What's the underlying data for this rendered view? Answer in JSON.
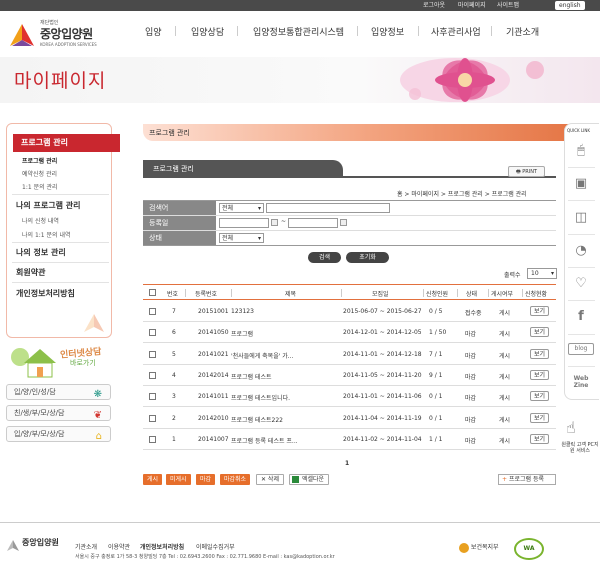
{
  "top_util": [
    "로그아웃",
    "마이페이지",
    "사이트맵",
    "english"
  ],
  "logo": {
    "sub": "재단법인",
    "main": "중앙입양원",
    "eng": "KOREA ADOPTION SERVICES"
  },
  "gnb": [
    "입양",
    "입양상담",
    "입양정보통합관리시스템",
    "입양정보",
    "사후관리사업",
    "기관소개"
  ],
  "banner_title": "마이페이지",
  "lnb": {
    "head": "프로그램 관리",
    "subs": [
      "프로그램 관리",
      "예약신청 관리",
      "1:1 문의 관리"
    ],
    "section2": "나의 프로그램 관리",
    "subs2": [
      "나의 신청 내역",
      "나의 1:1 문의 내역"
    ],
    "main_items": [
      "나의 정보 관리",
      "회원약관",
      "개인정보처리방침"
    ]
  },
  "promo": {
    "line1": "인터넷상담",
    "line2": "바로가기"
  },
  "side_buttons": [
    "입/양/인/성/담",
    "친/생/부/모/상/담",
    "입/양/부/모/상/담"
  ],
  "section_title": "프로그램 관리",
  "tab_title": "프로그램 관리",
  "print": "PRINT",
  "breadcrumb": "홈 > 마이페이지 > 프로그램 관리 > 프로그램 관리",
  "search": {
    "label_keyword": "검색어",
    "keyword_select": "전체",
    "label_date": "등록일",
    "date_sep": "~",
    "label_status": "상태",
    "status_select": "전체",
    "btn_search": "검색",
    "btn_reset": "초기화"
  },
  "per_page": {
    "label": "출력수",
    "value": "10"
  },
  "columns": [
    "번호",
    "등록번호",
    "제목",
    "모집일",
    "신청인원",
    "상태",
    "게시여부",
    "신청현황"
  ],
  "rows": [
    {
      "no": "7",
      "reg": "20151001",
      "title": "123123",
      "period": "2015-06-07 ~ 2015-06-27",
      "count": "0 / 5",
      "status": "접수중",
      "post": "게시",
      "view": "보기"
    },
    {
      "no": "6",
      "reg": "20141050",
      "title": "프로그램",
      "period": "2014-12-01 ~ 2014-12-05",
      "count": "1 / 50",
      "status": "마감",
      "post": "게시",
      "view": "보기"
    },
    {
      "no": "5",
      "reg": "20141021",
      "title": "'천사들에게 축복을' 가...",
      "period": "2014-11-01 ~ 2014-12-18",
      "count": "7 / 1",
      "status": "마감",
      "post": "게시",
      "view": "보기"
    },
    {
      "no": "4",
      "reg": "20142014",
      "title": "프로그램 테스트",
      "period": "2014-11-05 ~ 2014-11-20",
      "count": "9 / 1",
      "status": "마감",
      "post": "게시",
      "view": "보기"
    },
    {
      "no": "3",
      "reg": "20141011",
      "title": "프로그램 테스트입니다.",
      "period": "2014-11-01 ~ 2014-11-06",
      "count": "0 / 1",
      "status": "마감",
      "post": "게시",
      "view": "보기"
    },
    {
      "no": "2",
      "reg": "20142010",
      "title": "프로그램 테스트222",
      "period": "2014-11-04 ~ 2014-11-19",
      "count": "0 / 1",
      "status": "마감",
      "post": "게시",
      "view": "보기"
    },
    {
      "no": "1",
      "reg": "20141007",
      "title": "프로그램 등록 테스트 프...",
      "period": "2014-11-02 ~ 2014-11-04",
      "count": "1 / 1",
      "status": "마감",
      "post": "게시",
      "view": "보기"
    }
  ],
  "pager": "1",
  "actions": [
    "게시",
    "미게시",
    "마감",
    "마감취소",
    "✕ 삭제",
    "엑셀다운"
  ],
  "register": "프로그램 등록",
  "quick": {
    "label": "QUICK LINK",
    "items": [
      "blog",
      "Web Zine"
    ],
    "pc_text": "원클릭 고객 PC지원 서비스"
  },
  "footer": {
    "logo": "중앙입양원",
    "links": [
      "기관소개",
      "이용약관",
      "개인정보처리방침",
      "이메일수집거부"
    ],
    "address": "서울시 중구 충정로 1가 58-3 청양빌딩 7층 Tel : 02.6943.2600   Fax : 02.771.9680  E-mail : kas@kadoption.or.kr",
    "badge1": "보건복지부",
    "badge2": "WA"
  },
  "colors": {
    "accent": "#c9272f",
    "orange": "#e66e2b",
    "dark": "#555555"
  }
}
